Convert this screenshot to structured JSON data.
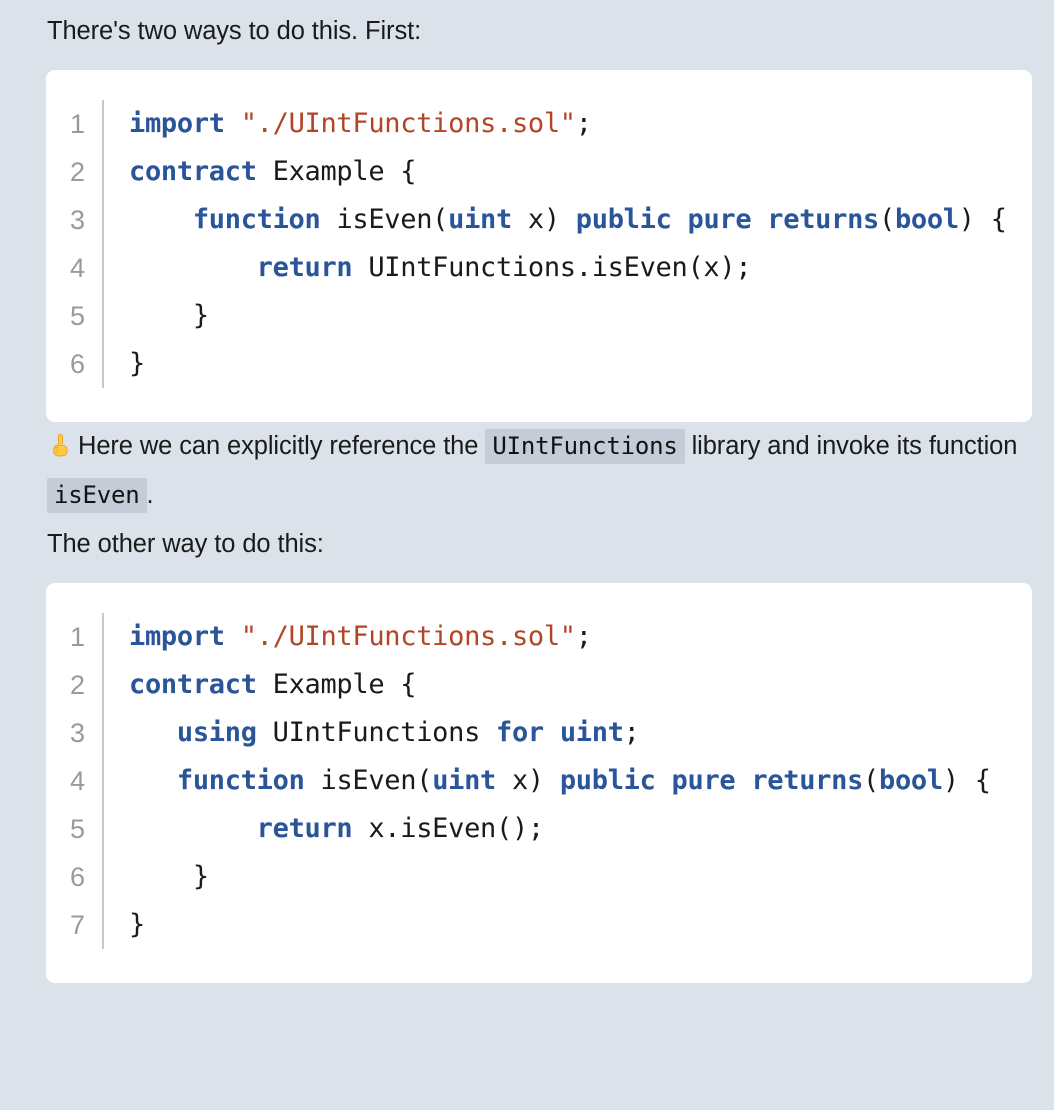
{
  "theme": {
    "page_background": "#dce2ea",
    "code_background": "#ffffff",
    "keyword_color": "#2a5699",
    "string_color": "#b24525",
    "plain_color": "#1a1a1a",
    "gutter_color": "#9a9a9a",
    "inline_code_background": "#c4ccd8"
  },
  "paragraphs": {
    "intro": "There's two ways to do this. First:",
    "note_emoji": "index-pointing-up",
    "note_part1": "Here we can explicitly reference the",
    "note_code1": "UIntFunctions",
    "note_part2": "library and invoke its function",
    "note_code2": "isEven",
    "note_part3": ".",
    "other": "The other way to do this:"
  },
  "code_blocks": [
    {
      "name": "explicit-library-reference-example",
      "line_numbers": [
        "1",
        "2",
        "3",
        "4",
        "5",
        "6"
      ],
      "lines": [
        [
          {
            "t": "import",
            "c": "kw"
          },
          {
            "t": " ",
            "c": "pln"
          },
          {
            "t": "\"./UIntFunctions.sol\"",
            "c": "str"
          },
          {
            "t": ";",
            "c": "pln"
          }
        ],
        [
          {
            "t": "contract",
            "c": "kw"
          },
          {
            "t": " Example {",
            "c": "pln"
          }
        ],
        [
          {
            "t": "    ",
            "c": "pln"
          },
          {
            "t": "function",
            "c": "kw"
          },
          {
            "t": " isEven(",
            "c": "pln"
          },
          {
            "t": "uint",
            "c": "kw"
          },
          {
            "t": " x) ",
            "c": "pln"
          },
          {
            "t": "public",
            "c": "kw"
          },
          {
            "t": " ",
            "c": "pln"
          },
          {
            "t": "pure",
            "c": "kw"
          },
          {
            "t": " ",
            "c": "pln"
          },
          {
            "t": "returns",
            "c": "kw"
          },
          {
            "t": "(",
            "c": "pln"
          },
          {
            "t": "bool",
            "c": "kw"
          },
          {
            "t": ") {",
            "c": "pln"
          }
        ],
        [
          {
            "t": "        ",
            "c": "pln"
          },
          {
            "t": "return",
            "c": "kw"
          },
          {
            "t": " UIntFunctions.isEven(x);",
            "c": "pln"
          }
        ],
        [
          {
            "t": "    }",
            "c": "pln"
          }
        ],
        [
          {
            "t": "}",
            "c": "pln"
          }
        ]
      ]
    },
    {
      "name": "using-for-directive-example",
      "line_numbers": [
        "1",
        "2",
        "3",
        "4",
        "5",
        "6",
        "7"
      ],
      "lines": [
        [
          {
            "t": "import",
            "c": "kw"
          },
          {
            "t": " ",
            "c": "pln"
          },
          {
            "t": "\"./UIntFunctions.sol\"",
            "c": "str"
          },
          {
            "t": ";",
            "c": "pln"
          }
        ],
        [
          {
            "t": "contract",
            "c": "kw"
          },
          {
            "t": " Example {",
            "c": "pln"
          }
        ],
        [
          {
            "t": "   ",
            "c": "pln"
          },
          {
            "t": "using",
            "c": "kw"
          },
          {
            "t": " UIntFunctions ",
            "c": "pln"
          },
          {
            "t": "for",
            "c": "kw"
          },
          {
            "t": " ",
            "c": "pln"
          },
          {
            "t": "uint",
            "c": "kw"
          },
          {
            "t": ";",
            "c": "pln"
          }
        ],
        [
          {
            "t": "   ",
            "c": "pln"
          },
          {
            "t": "function",
            "c": "kw"
          },
          {
            "t": " isEven(",
            "c": "pln"
          },
          {
            "t": "uint",
            "c": "kw"
          },
          {
            "t": " x) ",
            "c": "pln"
          },
          {
            "t": "public",
            "c": "kw"
          },
          {
            "t": " ",
            "c": "pln"
          },
          {
            "t": "pure",
            "c": "kw"
          },
          {
            "t": " ",
            "c": "pln"
          },
          {
            "t": "returns",
            "c": "kw"
          },
          {
            "t": "(",
            "c": "pln"
          },
          {
            "t": "bool",
            "c": "kw"
          },
          {
            "t": ") {",
            "c": "pln"
          }
        ],
        [
          {
            "t": "        ",
            "c": "pln"
          },
          {
            "t": "return",
            "c": "kw"
          },
          {
            "t": " x.isEven();",
            "c": "pln"
          }
        ],
        [
          {
            "t": "    }",
            "c": "pln"
          }
        ],
        [
          {
            "t": "}",
            "c": "pln"
          }
        ]
      ]
    }
  ]
}
